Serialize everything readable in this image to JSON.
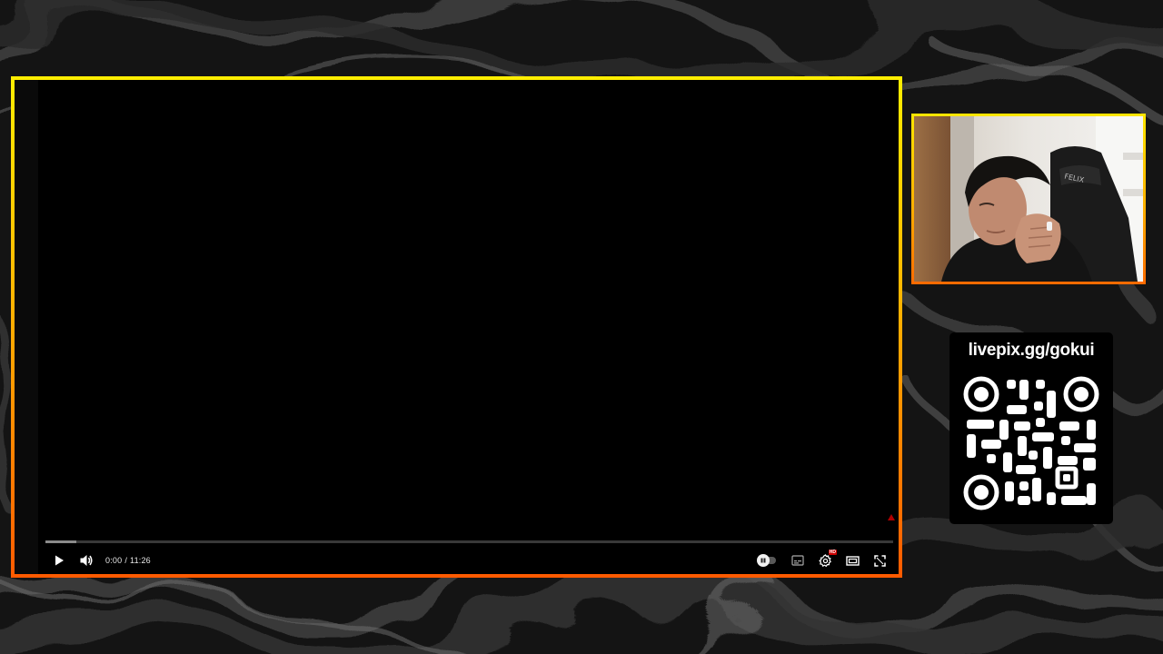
{
  "overlay": {
    "background_color": "#0e0e0e",
    "frame_gradient": [
      "#ffee00",
      "#ffb400",
      "#ff5a00"
    ]
  },
  "player": {
    "current_time": "0:00",
    "separator": "/",
    "duration": "11:26",
    "played_fraction": 0.0,
    "buffered_fraction": 0.036,
    "autoplay_on": true,
    "quality_badge": "HD",
    "icons": {
      "play": "play-icon",
      "volume": "volume-icon",
      "autoplay": "autoplay-toggle",
      "subtitles": "subtitles-icon",
      "settings": "gear-icon",
      "theater": "theater-mode-icon",
      "fullscreen": "fullscreen-icon"
    },
    "accent_color": "#ff0000"
  },
  "webcam": {
    "chair_brand": "FELIX"
  },
  "donation": {
    "url": "livepix.gg/gokui"
  }
}
